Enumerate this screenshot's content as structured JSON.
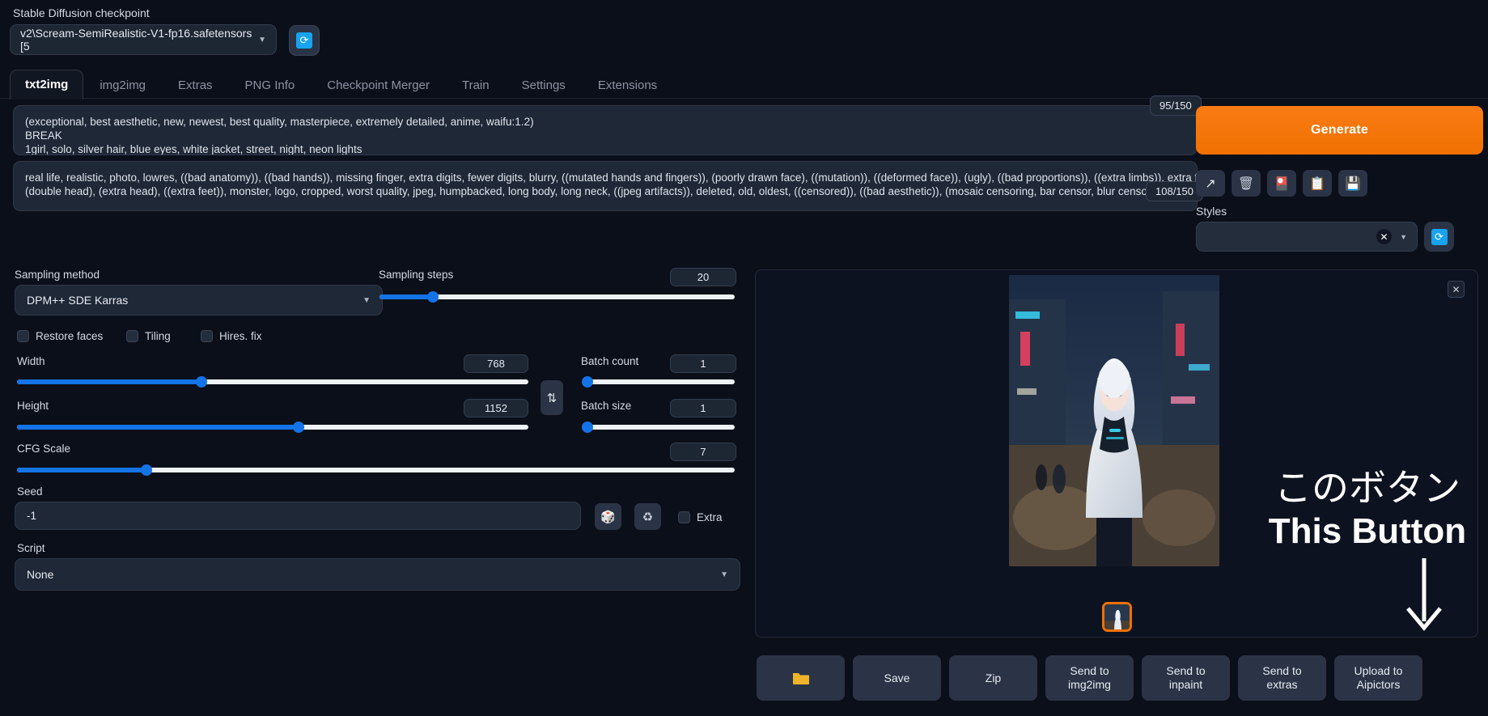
{
  "checkpoint": {
    "label": "Stable Diffusion checkpoint",
    "value": "v2\\Scream-SemiRealistic-V1-fp16.safetensors [5",
    "caret": "▼",
    "refresh_icon": "🔄"
  },
  "tabs": [
    {
      "label": "txt2img",
      "active": true
    },
    {
      "label": "img2img",
      "active": false
    },
    {
      "label": "Extras",
      "active": false
    },
    {
      "label": "PNG Info",
      "active": false
    },
    {
      "label": "Checkpoint Merger",
      "active": false
    },
    {
      "label": "Train",
      "active": false
    },
    {
      "label": "Settings",
      "active": false
    },
    {
      "label": "Extensions",
      "active": false
    }
  ],
  "prompt": {
    "positive_line1": "(exceptional, best aesthetic, new, newest, best quality, masterpiece, extremely detailed, anime, waifu:1.2)",
    "positive_line2": "BREAK",
    "positive_line3": "1girl, solo, silver hair, blue eyes, white jacket, street, night, neon lights",
    "positive_tokens": "95/150",
    "negative_line1": "real life, realistic, photo, lowres, ((bad anatomy)), ((bad hands)), missing finger, extra digits, fewer digits, blurry, ((mutated hands and fingers)), (poorly drawn face), ((mutation)), ((deformed face)), (ugly), ((bad proportions)), ((extra limbs)), extra face,",
    "negative_line2": "(double head), (extra head), ((extra feet)), monster, logo, cropped, worst quality, jpeg, humpbacked, long body, long neck, ((jpeg artifacts)), deleted, old, oldest, ((censored)), ((bad aesthetic)), (mosaic censoring, bar censor, blur censor)",
    "negative_tokens": "108/150"
  },
  "right_panel": {
    "generate_label": "Generate",
    "tools": [
      {
        "name": "arrow-restore-icon",
        "glyph": "↗"
      },
      {
        "name": "trash-icon",
        "glyph": "🗑"
      },
      {
        "name": "extra-networks-icon",
        "glyph": "🎴"
      },
      {
        "name": "apply-style-icon",
        "glyph": "📋"
      },
      {
        "name": "save-style-icon",
        "glyph": "💾"
      }
    ],
    "styles_label": "Styles",
    "styles_value": "",
    "styles_clear": "✕",
    "styles_caret": "▼",
    "styles_refresh_icon": "🔄"
  },
  "settings": {
    "sampling_method": {
      "label": "Sampling method",
      "value": "DPM++ SDE Karras",
      "caret": "▼"
    },
    "sampling_steps": {
      "label": "Sampling steps",
      "value": "20",
      "fill_pct": 15
    },
    "checkboxes": [
      {
        "label": "Restore faces",
        "checked": false
      },
      {
        "label": "Tiling",
        "checked": false
      },
      {
        "label": "Hires. fix",
        "checked": false
      }
    ],
    "width": {
      "label": "Width",
      "value": "768",
      "fill_pct": 36
    },
    "height": {
      "label": "Height",
      "value": "1152",
      "fill_pct": 55
    },
    "swap_icon": "⇅",
    "batch_count": {
      "label": "Batch count",
      "value": "1",
      "fill_pct": 0
    },
    "batch_size": {
      "label": "Batch size",
      "value": "1",
      "fill_pct": 0
    },
    "cfg_scale": {
      "label": "CFG Scale",
      "value": "7",
      "fill_pct": 21
    },
    "seed": {
      "label": "Seed",
      "value": "-1"
    },
    "seed_buttons": [
      {
        "name": "dice-icon",
        "glyph": "🎲"
      },
      {
        "name": "recycle-icon",
        "glyph": "♻"
      }
    ],
    "extra_checkbox": {
      "label": "Extra",
      "checked": false
    },
    "script": {
      "label": "Script",
      "value": "None",
      "caret": "▼"
    }
  },
  "result": {
    "close_icon": "✕",
    "overlay_japanese": "このボタン",
    "overlay_english": "This Button",
    "arrow_icon": "arrow-down-icon"
  },
  "bottom_buttons": [
    {
      "name": "open-folder-button",
      "label": "📁",
      "is_icon": true
    },
    {
      "name": "save-button",
      "label": "Save",
      "is_icon": false
    },
    {
      "name": "zip-button",
      "label": "Zip",
      "is_icon": false
    },
    {
      "name": "send-to-img2img-button",
      "label": "Send to\nimg2img",
      "is_icon": false
    },
    {
      "name": "send-to-inpaint-button",
      "label": "Send to\ninpaint",
      "is_icon": false
    },
    {
      "name": "send-to-extras-button",
      "label": "Send to\nextras",
      "is_icon": false
    },
    {
      "name": "upload-to-aipictors-button",
      "label": "Upload to\nAipictors",
      "is_icon": false
    }
  ],
  "colors": {
    "accent_orange": "#f07100",
    "accent_blue": "#1473e6",
    "background": "#0b0f19",
    "panel": "#1f2836"
  }
}
